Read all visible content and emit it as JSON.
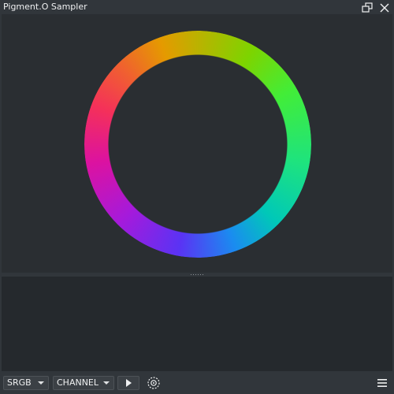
{
  "window": {
    "title": "Pigment.O Sampler",
    "float_icon": "float-window-icon",
    "close_icon": "close-icon"
  },
  "wheel": {
    "type": "hue-ring",
    "colors": [
      "#bbb200",
      "#7dd400",
      "#42ed38",
      "#1ee37e",
      "#00c8b8",
      "#1a8cf0",
      "#5a33f4",
      "#a51adb",
      "#dc12a0",
      "#f4305a",
      "#f06030",
      "#e59a00"
    ]
  },
  "toolbar": {
    "color_space": "SRGB",
    "channel": "CHANNEL",
    "play_icon": "play-icon",
    "settings_icon": "settings-gear-icon",
    "menu_icon": "hamburger-menu-icon"
  },
  "colors": {
    "panel_bg": "#2a2e32",
    "window_bg": "#31363b",
    "lower_bg": "#25292d",
    "text": "#eff0f1"
  }
}
